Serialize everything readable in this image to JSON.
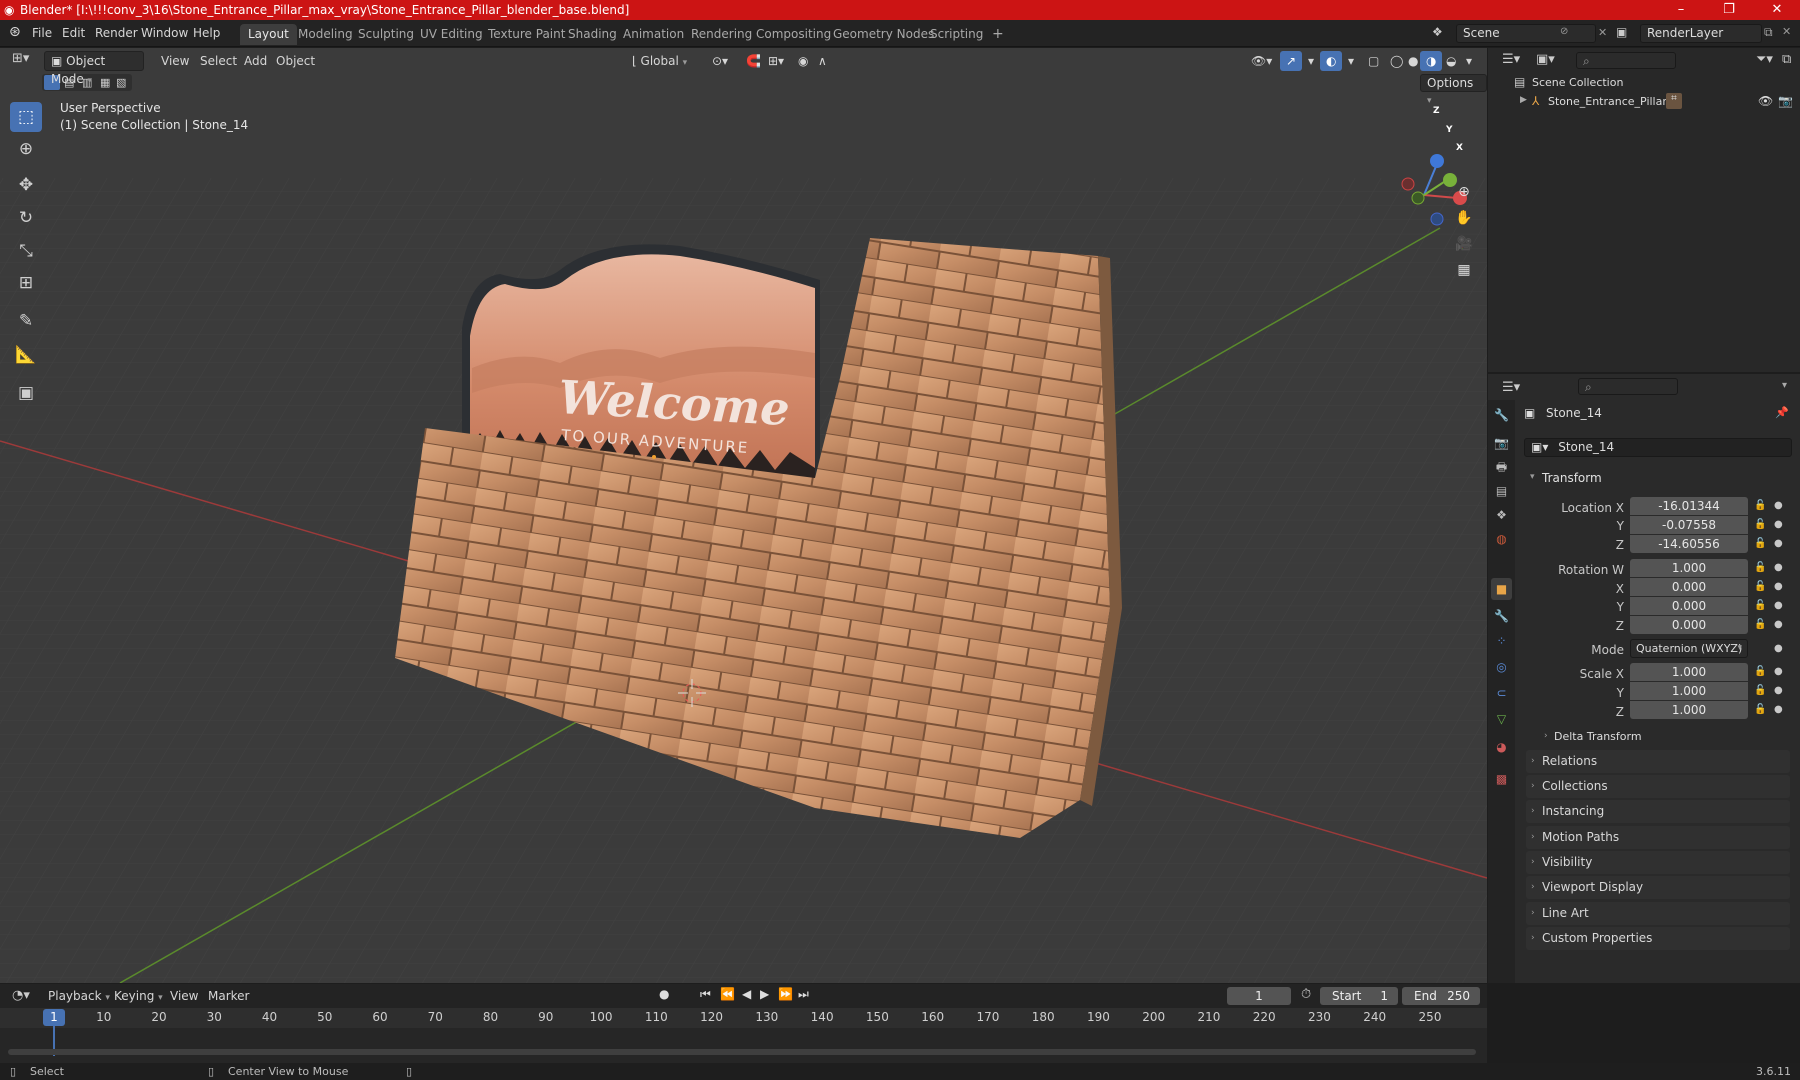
{
  "window": {
    "title": "Blender* [I:\\!!!conv_3\\16\\Stone_Entrance_Pillar_max_vray\\Stone_Entrance_Pillar_blender_base.blend]",
    "minimize": "–",
    "maximize": "❐",
    "close": "✕"
  },
  "menubar": {
    "menus": [
      "File",
      "Edit",
      "Render",
      "Window",
      "Help"
    ],
    "workspaces": [
      "Layout",
      "Modeling",
      "Sculpting",
      "UV Editing",
      "Texture Paint",
      "Shading",
      "Animation",
      "Rendering",
      "Compositing",
      "Geometry Nodes",
      "Scripting"
    ],
    "active_workspace": "Layout",
    "add_workspace": "+",
    "scene": "Scene",
    "view_layer": "RenderLayer"
  },
  "viewport_header": {
    "mode": "Object Mode",
    "menus": [
      "View",
      "Select",
      "Add",
      "Object"
    ],
    "orientation": "Global",
    "options": "Options"
  },
  "viewport": {
    "view_name": "User Perspective",
    "collection_info": "(1) Scene Collection | Stone_14",
    "sign_title": "Welcome",
    "sign_subtitle": "TO OUR ADVENTURE",
    "axis_x": "X",
    "axis_y": "Y",
    "axis_z": "Z"
  },
  "outliner": {
    "root": "Scene Collection",
    "items": [
      {
        "label": "Stone_Entrance_Pillar"
      }
    ]
  },
  "properties": {
    "object_name": "Stone_14",
    "data_name": "Stone_14",
    "transform_title": "Transform",
    "location": {
      "label": "Location X",
      "x": "-16.01344",
      "y": "-0.07558",
      "z": "-14.60556"
    },
    "rotation": {
      "label": "Rotation W",
      "w": "1.000",
      "x": "0.000",
      "y": "0.000",
      "z": "0.000"
    },
    "mode_label": "Mode",
    "mode_value": "Quaternion (WXYZ)",
    "scale": {
      "label": "Scale X",
      "x": "1.000",
      "y": "1.000",
      "z": "1.000"
    },
    "axis_labels": {
      "y": "Y",
      "z": "Z",
      "x": "X"
    },
    "delta_transform": "Delta Transform",
    "panels": [
      "Relations",
      "Collections",
      "Instancing",
      "Motion Paths",
      "Visibility",
      "Viewport Display",
      "Line Art",
      "Custom Properties"
    ]
  },
  "timeline": {
    "menus": [
      "Playback",
      "Keying",
      "View",
      "Marker"
    ],
    "current_frame": "1",
    "start_label": "Start",
    "start": "1",
    "end_label": "End",
    "end": "250",
    "ticks": [
      "1",
      "10",
      "20",
      "30",
      "40",
      "50",
      "60",
      "70",
      "80",
      "90",
      "100",
      "110",
      "120",
      "130",
      "140",
      "150",
      "160",
      "170",
      "180",
      "190",
      "200",
      "210",
      "220",
      "230",
      "240",
      "250"
    ]
  },
  "statusbar": {
    "select": "Select",
    "center": "Center View to Mouse",
    "version": "3.6.11"
  },
  "colors": {
    "titlebar": "#cc1414",
    "accent": "#4772b3",
    "viewport_bg": "#3b3b3b"
  }
}
